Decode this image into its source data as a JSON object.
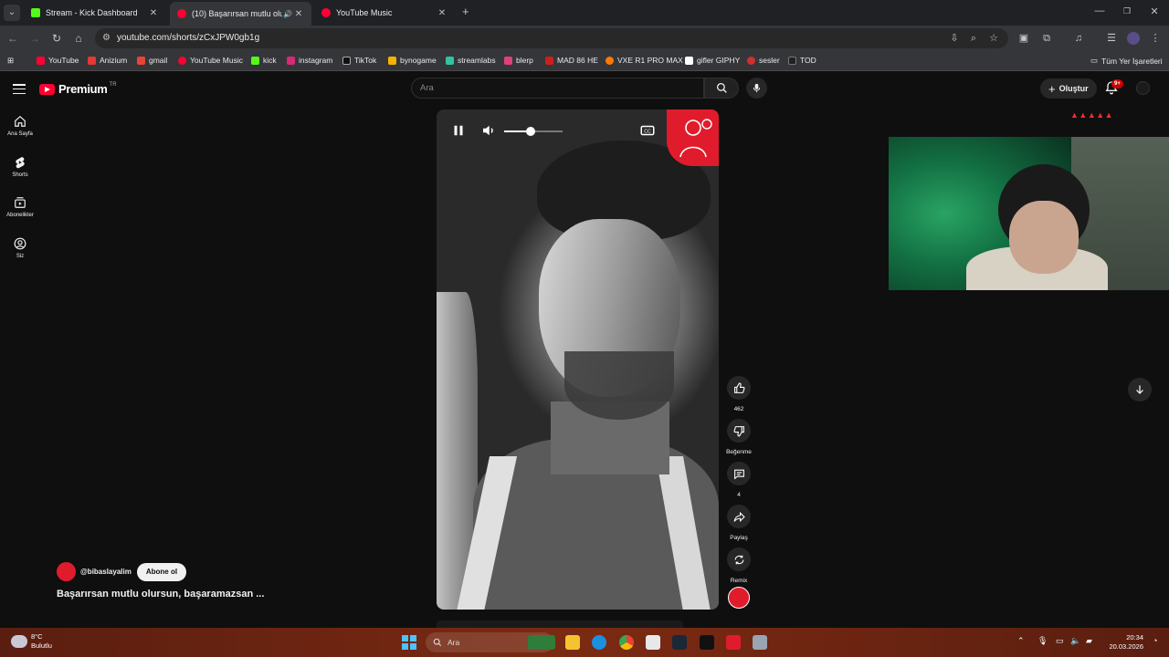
{
  "browser": {
    "tabs": [
      {
        "title": "Stream - Kick Dashboard",
        "color": "#53fc18"
      },
      {
        "title": "(10) Başarırsan mutlu olursu",
        "color": "#ff0033"
      },
      {
        "title": "YouTube Music",
        "color": "#ff0033"
      }
    ],
    "url": "youtube.com/shorts/zCxJPW0gb1g",
    "bookmarks": [
      {
        "label": "YouTube",
        "color": "#ff0033"
      },
      {
        "label": "Anizium",
        "color": "#e53935"
      },
      {
        "label": "gmail",
        "color": "#ea4335"
      },
      {
        "label": "YouTube Music",
        "color": "#ff0033"
      },
      {
        "label": "kick",
        "color": "#53fc18"
      },
      {
        "label": "instagram",
        "color": "#d62976"
      },
      {
        "label": "TikTok",
        "color": "#ffffff"
      },
      {
        "label": "bynogame",
        "color": "#f5b301"
      },
      {
        "label": "streamlabs",
        "color": "#31c3a2"
      },
      {
        "label": "blerp",
        "color": "#e0407a"
      },
      {
        "label": "MAD 86 HE",
        "color": "#cc1f1f"
      },
      {
        "label": "VXE R1 PRO MAX",
        "color": "#ff7a00"
      },
      {
        "label": "gifler GIPHY",
        "color": "#ffffff"
      },
      {
        "label": "sesler",
        "color": "#d32f2f"
      },
      {
        "label": "TOD",
        "color": "#111111"
      }
    ],
    "all_bookmarks": "Tüm Yer İşaretleri"
  },
  "youtube": {
    "brand": "Premium",
    "brand_country": "TR",
    "search_placeholder": "Ara",
    "create_label": "Oluştur",
    "notif_badge": "9+",
    "sidebar": [
      {
        "label": "Ana Sayfa",
        "icon": "home-icon"
      },
      {
        "label": "Shorts",
        "icon": "shorts-icon"
      },
      {
        "label": "Abonelikler",
        "icon": "subscriptions-icon"
      },
      {
        "label": "Siz",
        "icon": "you-icon"
      }
    ],
    "player": {
      "volume_fraction": 0.45
    },
    "actions": {
      "like_count": "462",
      "dislike_label": "Beğenme",
      "comments_count": "4",
      "share_label": "Paylaş",
      "remix_label": "Remix"
    },
    "channel": "@bibaslayalim",
    "subscribe_label": "Abone ol",
    "title": "Başarırsan mutlu olursun, başaramazsan ..."
  },
  "taskbar": {
    "temperature": "8°C",
    "weather": "Bulutlu",
    "search_placeholder": "Ara",
    "time": "20:34",
    "date": "20.03.2026"
  }
}
